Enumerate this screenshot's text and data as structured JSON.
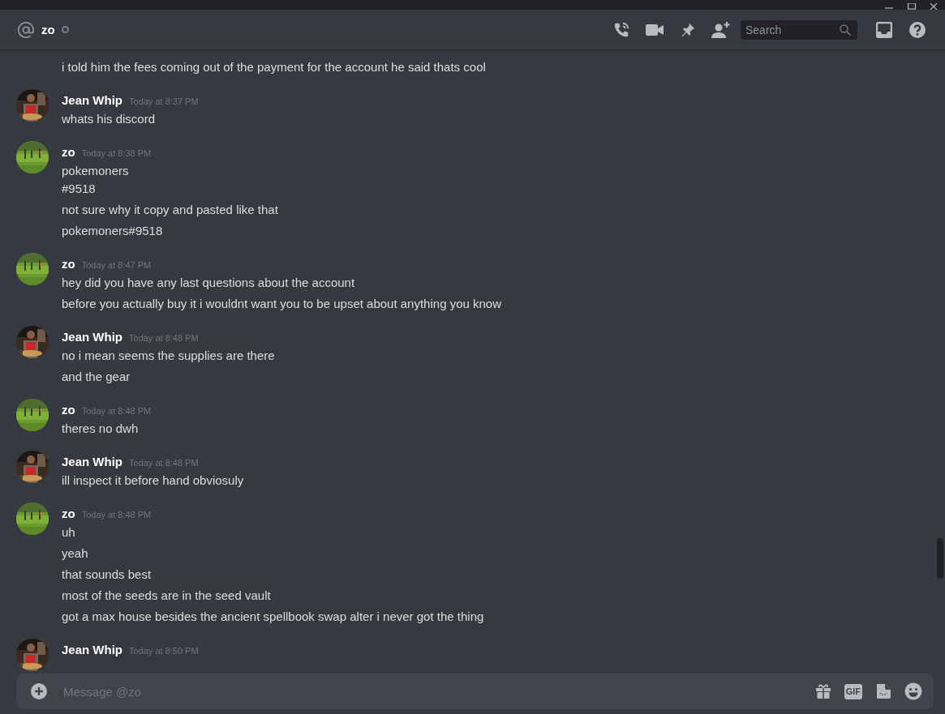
{
  "header": {
    "channel_name": "zo",
    "online": false
  },
  "search": {
    "placeholder": "Search"
  },
  "messages": [
    {
      "kind": "continuation",
      "lines": [
        "i told him the fees coming out of the payment for the account he said thats cool"
      ]
    },
    {
      "kind": "group",
      "author": "Jean Whip",
      "time": "Today at 8:37 PM",
      "lines": [
        "whats his discord"
      ]
    },
    {
      "kind": "group",
      "author": "zo",
      "time": "Today at 8:38 PM",
      "lines": [
        "pokemoners\n#9518",
        "not sure why it copy and pasted like that",
        "pokemoners#9518"
      ]
    },
    {
      "kind": "group",
      "author": "zo",
      "time": "Today at 8:47 PM",
      "lines": [
        "hey did you have any last questions about the account",
        "before you actually buy it i wouldnt want you to be upset about anything you know"
      ]
    },
    {
      "kind": "group",
      "author": "Jean Whip",
      "time": "Today at 8:48 PM",
      "lines": [
        "no i mean seems the supplies are there",
        "and the gear"
      ]
    },
    {
      "kind": "group",
      "author": "zo",
      "time": "Today at 8:48 PM",
      "lines": [
        "theres no dwh"
      ]
    },
    {
      "kind": "group",
      "author": "Jean Whip",
      "time": "Today at 8:48 PM",
      "lines": [
        "ill inspect it before hand obviosuly"
      ]
    },
    {
      "kind": "group",
      "author": "zo",
      "time": "Today at 8:48 PM",
      "lines": [
        "uh",
        "yeah",
        "that sounds best",
        "most of the seeds are in the seed vault",
        "got a max house besides the ancient spellbook swap alter i never got the thing"
      ]
    },
    {
      "kind": "group",
      "author": "Jean Whip",
      "time": "Today at 8:50 PM"
    }
  ],
  "composer": {
    "placeholder": "Message @zo",
    "gif_label": "GIF"
  }
}
